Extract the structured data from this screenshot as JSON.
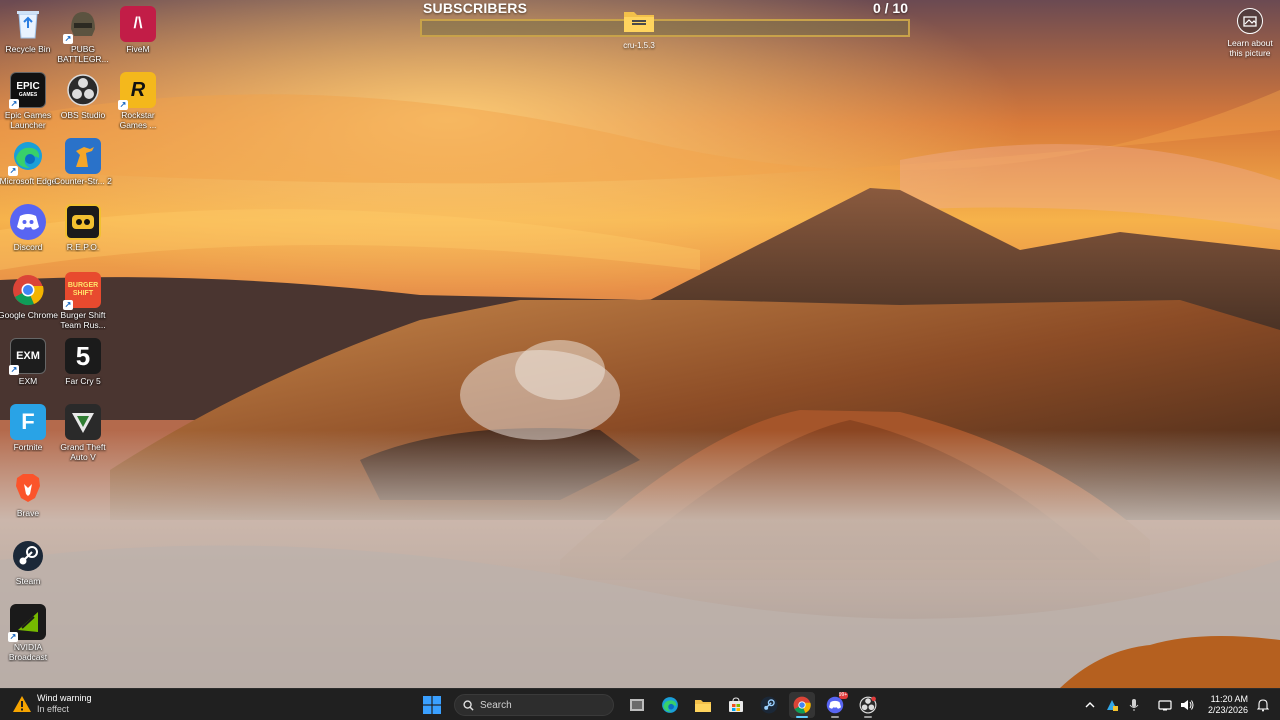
{
  "subscribers": {
    "title": "SUBSCRIBERS",
    "count_text": "0  / 10",
    "progress_fraction": 0.0
  },
  "folder": {
    "label": "cru-1.5.3",
    "icon": "folder-icon"
  },
  "learn": {
    "label": "Learn about this picture",
    "icon": "camera-icon"
  },
  "desktop_icons": [
    {
      "label": "Recycle Bin",
      "icon": "recycle-bin-icon",
      "color": "#cfe6ff"
    },
    {
      "label": "PUBG BATTLEGR...",
      "icon": "pubg-icon",
      "color": "#7a6a4a"
    },
    {
      "label": "FiveM",
      "icon": "fivem-icon",
      "color": "#c21d47"
    },
    {
      "label": "Epic Games Launcher",
      "icon": "epic-games-icon",
      "color": "#111111"
    },
    {
      "label": "OBS Studio",
      "icon": "obs-icon",
      "color": "#2b2b2b"
    },
    {
      "label": "Rockstar Games ...",
      "icon": "rockstar-icon",
      "color": "#f4b81c"
    },
    {
      "label": "Microsoft Edge",
      "icon": "edge-icon",
      "color": "#1a9fd8"
    },
    {
      "label": "Counter-Str... 2",
      "icon": "counter-strike-icon",
      "color": "#2a72c9"
    },
    {
      "label": "Discord",
      "icon": "discord-icon",
      "color": "#5865f2"
    },
    {
      "label": "R.E.P.O.",
      "icon": "repo-icon",
      "color": "#1b1b1b"
    },
    {
      "label": "Google Chrome",
      "icon": "chrome-icon",
      "color": "#ffffff"
    },
    {
      "label": "Burger Shift Team Rus...",
      "icon": "burger-shift-icon",
      "color": "#e84a2e"
    },
    {
      "label": "EXM",
      "icon": "exm-icon",
      "color": "#1d1d1d"
    },
    {
      "label": "Far Cry 5",
      "icon": "far-cry-icon",
      "color": "#1b1b1b"
    },
    {
      "label": "Fortnite",
      "icon": "fortnite-icon",
      "color": "#29a3e6"
    },
    {
      "label": "Grand Theft Auto V",
      "icon": "gta-icon",
      "color": "#2a2a2a"
    },
    {
      "label": "Brave",
      "icon": "brave-icon",
      "color": "#fb542b"
    },
    {
      "label": "Steam",
      "icon": "steam-icon",
      "color": "#1b2838"
    },
    {
      "label": "NVIDIA Broadcast",
      "icon": "nvidia-icon",
      "color": "#1a1a1a"
    }
  ],
  "desktop_glyphs": {
    "fivem": "/\\",
    "epic_top": "EPIC",
    "epic_bottom": "GAMES",
    "rockstar": "R",
    "exm": "EXM",
    "far_cry": "5",
    "fortnite": "F",
    "burger": "BURGER SHIFT"
  },
  "weather": {
    "title": "Wind warning",
    "subtitle": "In effect",
    "icon": "warning-icon"
  },
  "taskbar": {
    "search_label": "Search",
    "apps": [
      {
        "name": "start",
        "icon": "windows-icon"
      },
      {
        "name": "task-view",
        "icon": "task-view-icon"
      },
      {
        "name": "edge",
        "icon": "edge-icon"
      },
      {
        "name": "file-explorer",
        "icon": "folder-icon"
      },
      {
        "name": "store",
        "icon": "store-icon"
      },
      {
        "name": "steam",
        "icon": "steam-icon"
      },
      {
        "name": "chrome",
        "icon": "chrome-icon",
        "active": true
      },
      {
        "name": "discord",
        "icon": "discord-icon",
        "badge": "99+"
      },
      {
        "name": "obs",
        "icon": "obs-icon"
      }
    ]
  },
  "tray": {
    "time": "11:20 AM",
    "date": "2/23/2026",
    "icons": [
      "chevron-up-icon",
      "network-share-icon",
      "microphone-icon",
      "wifi-icon",
      "speaker-icon",
      "notification-icon"
    ]
  },
  "colors": {
    "taskbar": "#202020",
    "accent": "#60cdff",
    "progress_border": "#c8a24a"
  }
}
